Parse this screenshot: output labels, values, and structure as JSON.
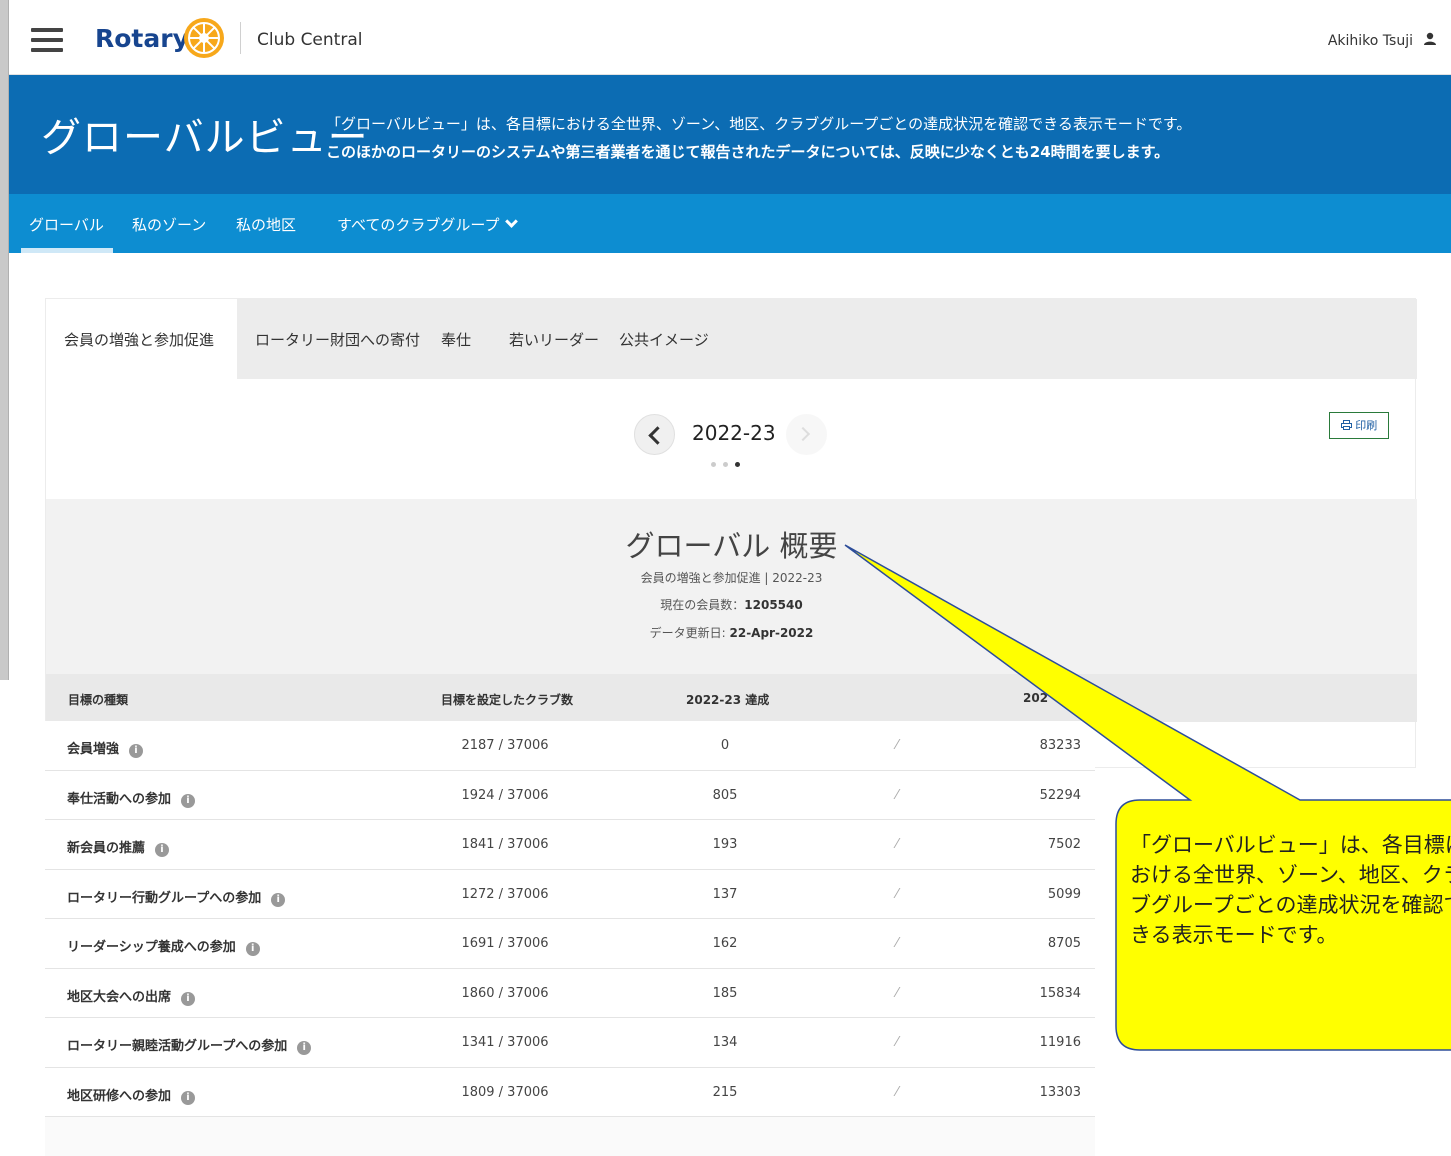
{
  "topbar": {
    "brand": "Rotary",
    "app_name": "Club Central",
    "user_name": "Akihiko Tsuji",
    "menu_icon": "hamburger-menu-icon",
    "user_icon": "user-icon"
  },
  "hero": {
    "title": "グローバルビュー",
    "description_1": "「グローバルビュー」は、各目標における全世界、ゾーン、地区、クラブグループごとの達成状況を確認できる表示モードです。",
    "description_2": "このほかのロータリーのシステムや第三者業者を通じて報告されたデータについては、反映に少なくとも24時間を要します。"
  },
  "subnav": {
    "items": [
      {
        "label": "グローバル",
        "active": true
      },
      {
        "label": "私のゾーン"
      },
      {
        "label": "私の地区"
      },
      {
        "label": "すべてのクラブグループ"
      }
    ]
  },
  "tabs": [
    {
      "label": "会員の増強と参加促進",
      "active": true
    },
    {
      "label": "ロータリー財団への寄付"
    },
    {
      "label": "奉仕"
    },
    {
      "label": "若いリーダー"
    },
    {
      "label": "公共イメージ"
    }
  ],
  "year_nav": {
    "label": "2022-23",
    "page_count": 3,
    "active_page": 3
  },
  "print_label": "印刷",
  "overview": {
    "title": "グローバル 概要",
    "subtitle": "会員の増強と参加促進 | 2022-23",
    "members_label": "現在の会員数：",
    "members_value": "1205540",
    "updated_label": "データ更新日: ",
    "updated_value": "22-Apr-2022"
  },
  "table": {
    "headers": {
      "type": "目標の種類",
      "clubs_set": "目標を設定したクラブ数",
      "achieved": "2022-23 達成",
      "prev": "202"
    },
    "rows": [
      {
        "name": "会員増強",
        "clubs_set": "2187 / 37006",
        "achieved": "0",
        "prev": "83233"
      },
      {
        "name": "奉仕活動への参加",
        "clubs_set": "1924 / 37006",
        "achieved": "805",
        "prev": "52294"
      },
      {
        "name": "新会員の推薦",
        "clubs_set": "1841 / 37006",
        "achieved": "193",
        "prev": "7502"
      },
      {
        "name": "ロータリー行動グループへの参加",
        "clubs_set": "1272 / 37006",
        "achieved": "137",
        "prev": "5099"
      },
      {
        "name": "リーダーシップ養成への参加",
        "clubs_set": "1691 / 37006",
        "achieved": "162",
        "prev": "8705"
      },
      {
        "name": "地区大会への出席",
        "clubs_set": "1860 / 37006",
        "achieved": "185",
        "prev": "15834"
      },
      {
        "name": "ロータリー親睦活動グループへの参加",
        "clubs_set": "1341 / 37006",
        "achieved": "134",
        "prev": "11916"
      },
      {
        "name": "地区研修への参加",
        "clubs_set": "1809 / 37006",
        "achieved": "215",
        "prev": "13303"
      }
    ]
  },
  "callout": {
    "text": "「グローバルビュー」は、各目標における全世界、ゾーン、地区、クラブグループごとの達成状況を確認できる表示モードです。",
    "color": "#ffff00"
  }
}
